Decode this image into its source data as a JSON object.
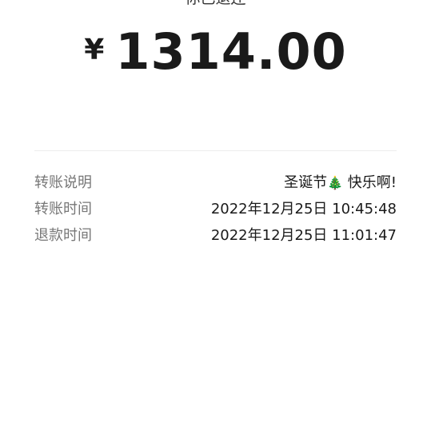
{
  "status_text": "你已退还",
  "amount": {
    "currency": "¥",
    "value": "1314.00"
  },
  "details": [
    {
      "label": "转账说明",
      "value_before": "圣诞节",
      "icon": "christmas-tree-icon",
      "value_after": " 快乐啊!"
    },
    {
      "label": "转账时间",
      "value": "2022年12月25日 10:45:48"
    },
    {
      "label": "退款时间",
      "value": "2022年12月25日 11:01:47"
    }
  ]
}
